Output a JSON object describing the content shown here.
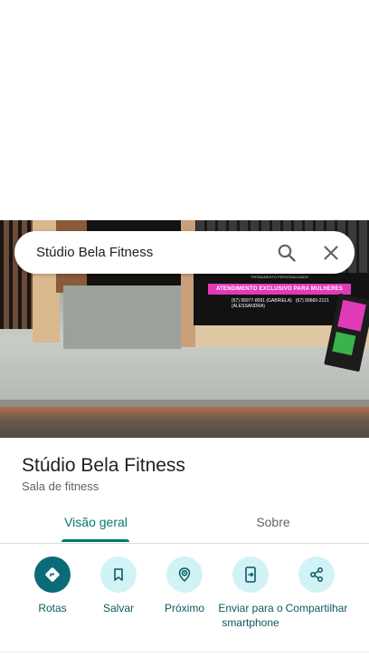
{
  "search": {
    "query": "Stúdio Bela Fitness",
    "search_icon": "search-icon",
    "close_icon": "close-icon"
  },
  "photo": {
    "banner_top": "TREINAMENTO PERSONALIZADO",
    "banner_text": "ATENDIMENTO EXCLUSIVO PARA MULHERES",
    "phone_1": "(67) 99977-8091",
    "phone_1_name": "(GABRIELA)",
    "phone_2": "(67) 99660-2121",
    "phone_2_name": "(ALESSANDRA)"
  },
  "place": {
    "name": "Stúdio Bela Fitness",
    "category": "Sala de fitness"
  },
  "tabs": [
    {
      "label": "Visão geral",
      "active": true
    },
    {
      "label": "Sobre",
      "active": false
    }
  ],
  "actions": [
    {
      "label": "Rotas",
      "icon": "directions-icon",
      "primary": true
    },
    {
      "label": "Salvar",
      "icon": "bookmark-icon",
      "primary": false
    },
    {
      "label": "Próximo",
      "icon": "nearby-icon",
      "primary": false
    },
    {
      "label": "Enviar para o smartphone",
      "icon": "send-to-phone-icon",
      "primary": false
    },
    {
      "label": "Compartilhar",
      "icon": "share-icon",
      "primary": false
    }
  ],
  "colors": {
    "accent": "#00796b",
    "primary_action": "#0b6b78",
    "action_bg": "#d2f3f6",
    "action_label": "#0b5961"
  }
}
